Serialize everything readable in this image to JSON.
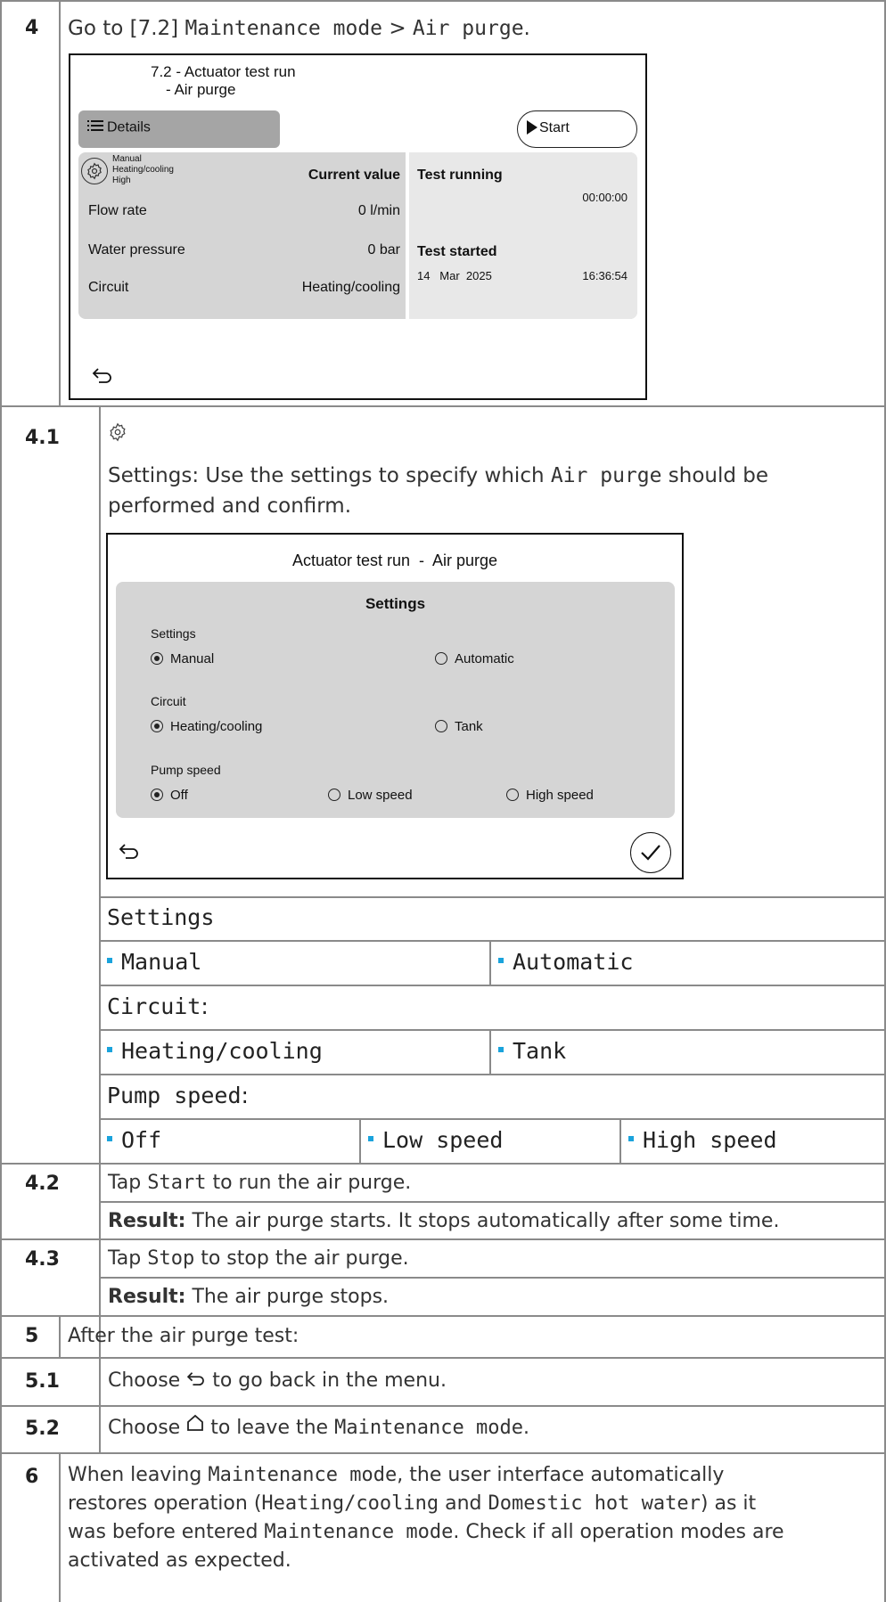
{
  "steps": {
    "s4": {
      "number": "4",
      "prefix": "Go to [7.2] ",
      "menu": "Maintenance mode",
      "sep": " > ",
      "item": "Air purge",
      "suffix": "."
    },
    "screen1": {
      "title_line1": "7.2 - Actuator test run",
      "title_line2": "- Air purge",
      "details_label": "Details",
      "start_label": "Start",
      "mini_manual": "Manual",
      "mini_circuit": "Heating/cooling",
      "mini_speed": "High",
      "current_value_header": "Current value",
      "rows": [
        {
          "label": "Flow rate",
          "value": "0 l/min"
        },
        {
          "label": "Water pressure",
          "value": "0 bar"
        },
        {
          "label": "Circuit",
          "value": "Heating/cooling"
        }
      ],
      "test_running": "Test running",
      "timer": "00:00:00",
      "test_started": "Test started",
      "date": "14   Mar  2025",
      "time": "16:36:54"
    },
    "s41": {
      "number": "4.1",
      "text_prefix": "Settings: Use the settings to specify which ",
      "text_mono": "Air purge",
      "text_suffix": " should be",
      "text_line2": "performed and confirm."
    },
    "screen2": {
      "title": "Actuator test run  -  Air purge",
      "panel_title": "Settings",
      "settings_label": "Settings",
      "settings_options": [
        "Manual",
        "Automatic"
      ],
      "circuit_label": "Circuit",
      "circuit_options": [
        "Heating/cooling",
        "Tank"
      ],
      "pump_label": "Pump speed",
      "pump_options": [
        "Off",
        "Low speed",
        "High speed"
      ]
    },
    "table": {
      "settings_header": "Settings",
      "settings_values": [
        "Manual",
        "Automatic"
      ],
      "circuit_header": "Circuit",
      "circuit_colon": ":",
      "circuit_values": [
        "Heating/cooling",
        "Tank"
      ],
      "pump_header": "Pump speed",
      "pump_colon": ":",
      "pump_values": [
        "Off",
        "Low speed",
        "High speed"
      ]
    },
    "s42": {
      "number": "4.2",
      "tap": "Tap ",
      "cmd": "Start",
      "rest": " to run the air purge.",
      "result_label": "Result:",
      "result_text": " The air purge starts. It stops automatically after some time."
    },
    "s43": {
      "number": "4.3",
      "tap": "Tap ",
      "cmd": "Stop",
      "rest": " to stop the air purge.",
      "result_label": "Result:",
      "result_text": " The air purge stops."
    },
    "s5": {
      "number": "5",
      "text": "After the air purge test:"
    },
    "s51": {
      "number": "5.1",
      "before": "Choose ",
      "after": " to go back in the menu."
    },
    "s52": {
      "number": "5.2",
      "before": "Choose ",
      "after": " to leave the ",
      "mono": "Maintenance mode",
      "end": "."
    },
    "s6": {
      "number": "6",
      "l1a": "When leaving ",
      "l1m": "Maintenance mode",
      "l1b": ", the user interface automatically",
      "l2a": "restores operation (",
      "l2m1": "Heating/cooling",
      "l2b": " and ",
      "l2m2": "Domestic hot water",
      "l2c": ") as it",
      "l3a": "was before entered ",
      "l3m": "Maintenance mode",
      "l3b": ". Check if all operation modes are",
      "l4": "activated as expected."
    }
  },
  "colors": {
    "bullet": "#1aa3dc",
    "panel": "#d5d5d5",
    "rule": "#8a8a8a"
  }
}
